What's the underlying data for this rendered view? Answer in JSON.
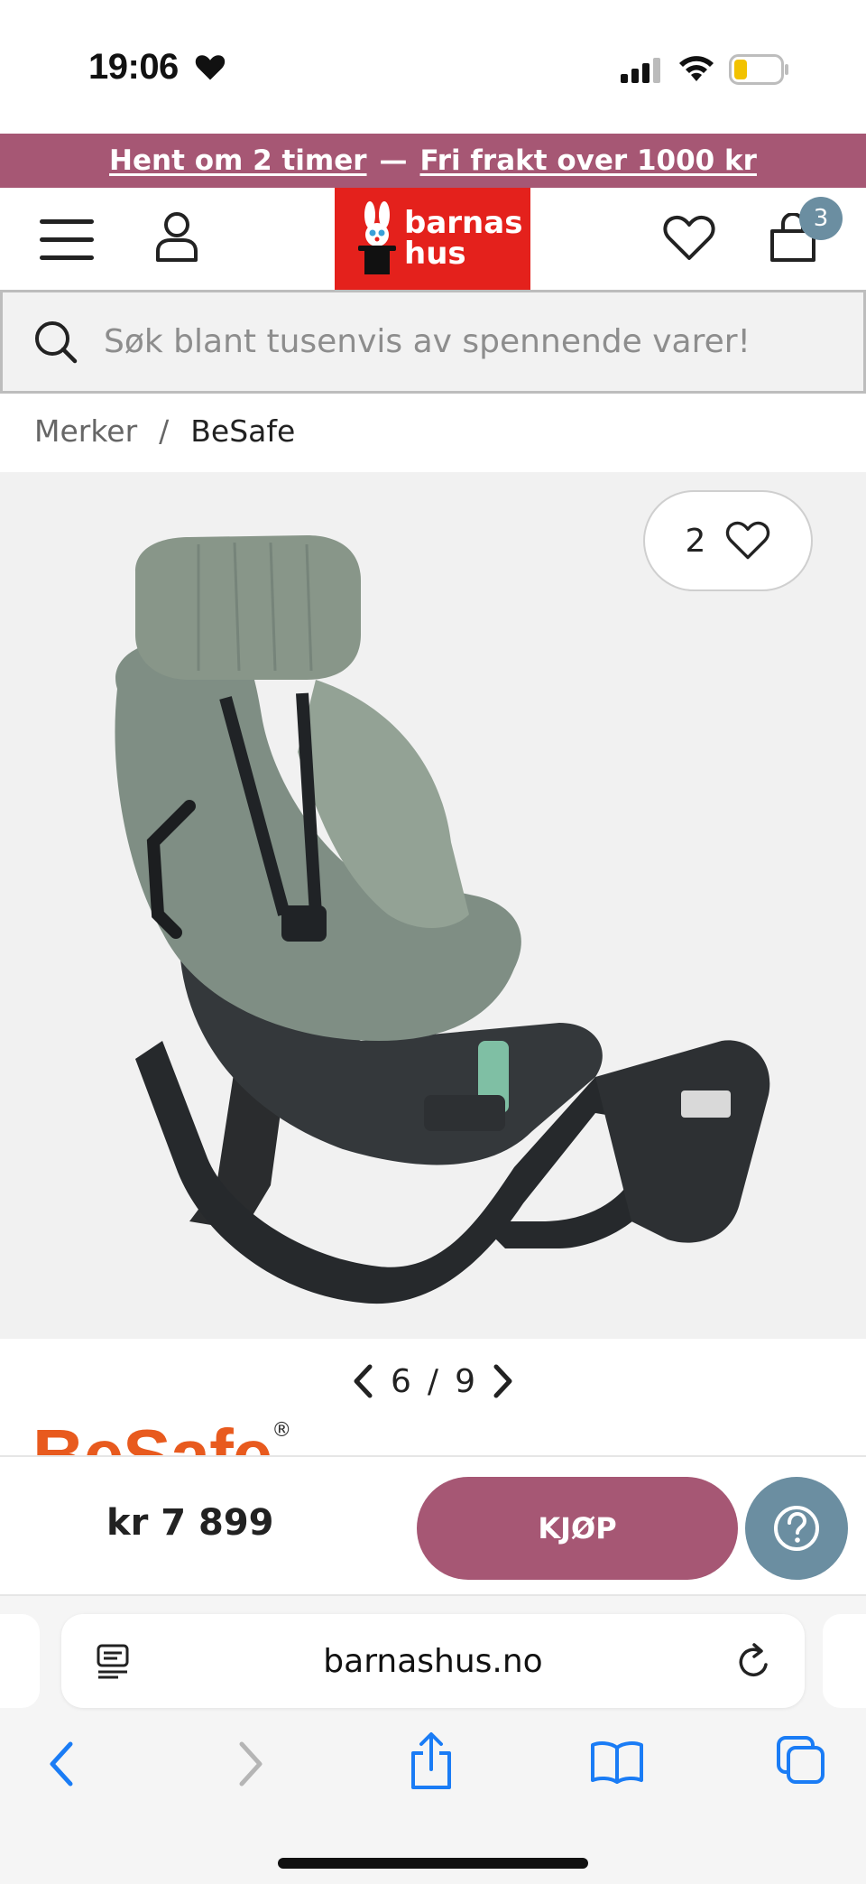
{
  "status_bar": {
    "time": "19:06"
  },
  "promo": {
    "part1": "Hent om 2 timer",
    "separator": "—",
    "part2": "Fri frakt over 1000 kr"
  },
  "header": {
    "logo_line1": "barnas",
    "logo_line2": "hus",
    "cart_count": "3"
  },
  "search": {
    "placeholder": "Søk blant tusenvis av spennende varer!"
  },
  "breadcrumb": {
    "items": [
      "Merker",
      "/",
      "BeSafe"
    ]
  },
  "gallery": {
    "favorite_count": "2",
    "current": "6",
    "separator": "/",
    "total": "9"
  },
  "brand": {
    "name": "BeSafe",
    "reg": "®"
  },
  "buy_bar": {
    "price": "kr 7 899",
    "buy_label": "KJØP"
  },
  "browser": {
    "url": "barnashus.no"
  },
  "colors": {
    "accent": "#a65774",
    "logo_red": "#e4211c",
    "help_blue": "#6b8ea1",
    "brand_orange": "#e85a1e",
    "ios_blue": "#1a7cf5"
  }
}
